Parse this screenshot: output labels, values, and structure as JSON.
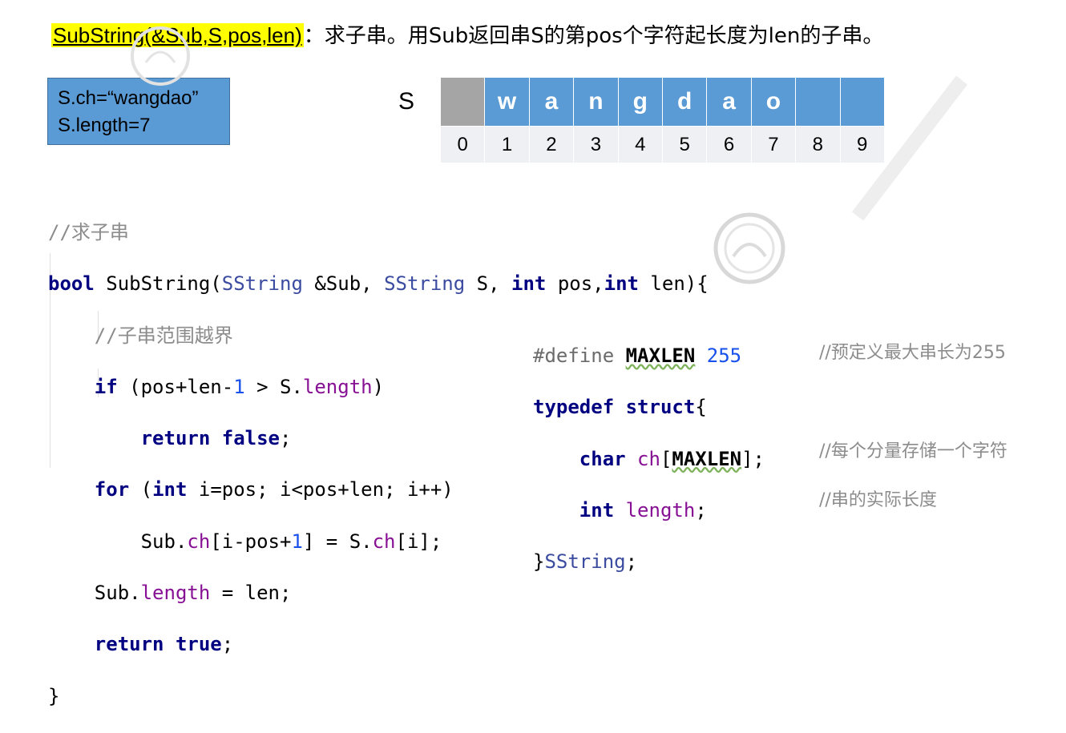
{
  "headline": {
    "function_sig": "SubString(&Sub,S,pos,len)",
    "description": "：求子串。用Sub返回串S的第pos个字符起长度为len的子串。"
  },
  "infobox": {
    "line1": "S.ch=“wangdao”",
    "line2": "S.length=7"
  },
  "string_table": {
    "label": "S",
    "chars": [
      "",
      "w",
      "a",
      "n",
      "g",
      "d",
      "a",
      "o",
      "",
      ""
    ],
    "indices": [
      "0",
      "1",
      "2",
      "3",
      "4",
      "5",
      "6",
      "7",
      "8",
      "9"
    ],
    "colors": {
      "cell": "#5b9bd5",
      "unused_cell": "#a5a5a5",
      "index_row": "#eef0f4"
    }
  },
  "code_left": {
    "comment_title": "//求子串",
    "kw_bool": "bool",
    "fn_name": " SubString(",
    "ty_sstring": "SString",
    "sub_param": " &Sub, ",
    "s_param": " S, ",
    "kw_int": "int",
    "pos_param": " pos,",
    "len_param": " len){",
    "comment_bounds": "//子串范围越界",
    "kw_if": "if",
    "if_expr_a": " (pos+len-",
    "num_one": "1",
    "if_expr_b": " > S.",
    "fd_length": "length",
    "if_expr_c": ")",
    "kw_return": "return",
    "kw_false": "false",
    "semicolon": ";",
    "kw_for": "for",
    "for_a": " (",
    "for_b": " i=pos; i<pos+len; i++)",
    "assign_a": "Sub.",
    "fd_ch": "ch",
    "assign_b": "[i-pos+",
    "assign_c": "] = S.",
    "assign_d": "[i];",
    "len_a": "Sub.",
    "len_b": " = len;",
    "kw_true": "true",
    "close_brace": "}"
  },
  "code_right": {
    "pp_define": "#define",
    "macro": "MAXLEN",
    "num_255": "255",
    "comment_define": "//预定义最大串长为255",
    "kw_typedef": "typedef",
    "kw_struct": "struct",
    "brace_open": "{",
    "kw_char": "char",
    "fd_ch": "ch",
    "bracket_open": "[",
    "bracket_close": "];",
    "comment_char": "//每个分量存储一个字符",
    "kw_int": "int",
    "fd_length": "length",
    "semicolon": ";",
    "comment_len": "//串的实际长度",
    "struct_close": "}",
    "type_name": "SString",
    "struct_end": ";"
  }
}
